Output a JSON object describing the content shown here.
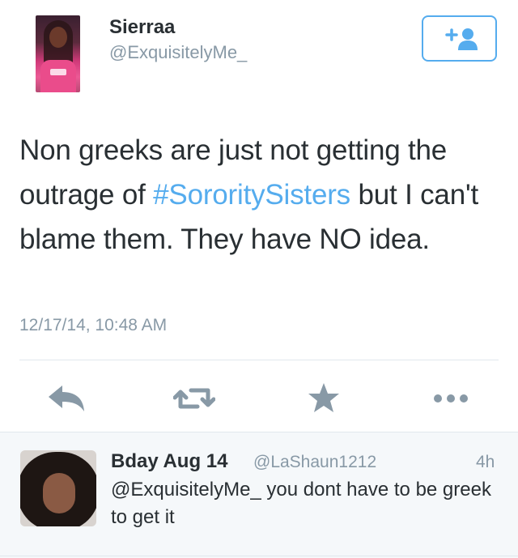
{
  "tweet": {
    "display_name": "Sierraa",
    "handle": "@ExquisitelyMe_",
    "text_before": "Non greeks are just not getting the outrage of ",
    "hashtag": "#SororitySisters",
    "text_after": " but I can't blame them. They have NO idea.",
    "timestamp": "12/17/14, 10:48 AM",
    "follow_icon": "add-user-icon",
    "actions": [
      "reply-icon",
      "retweet-icon",
      "favorite-icon",
      "more-icon"
    ]
  },
  "reply": {
    "display_name": "Bday Aug 14",
    "handle": "@LaShaun1212",
    "time": "4h",
    "mention": "@ExquisitelyMe_",
    "text": " you dont have to be greek to get it"
  },
  "colors": {
    "accent": "#55acee",
    "icon_gray": "#8899a6",
    "text": "#292f33",
    "divider": "#e1e8ed",
    "reply_bg": "#f5f8fa"
  }
}
